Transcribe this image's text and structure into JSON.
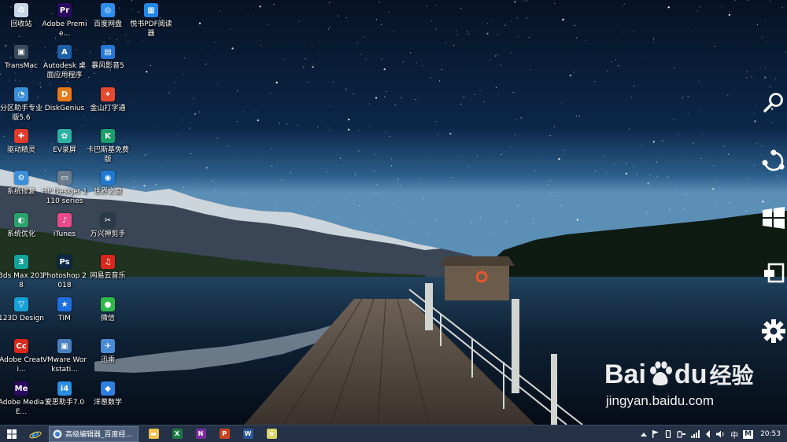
{
  "desktop": {
    "icons": [
      {
        "label": "回收站",
        "icon": "recycle-bin-icon",
        "color": "#c9d6e6",
        "glyph": "♻"
      },
      {
        "label": "Adobe Premie...",
        "icon": "premiere-icon",
        "color": "#2a0a5e",
        "glyph": "Pr"
      },
      {
        "label": "百度网盘",
        "icon": "baidu-netdisk-icon",
        "color": "#2d8cf0",
        "glyph": "◎"
      },
      {
        "label": "悦书PDF阅读器",
        "icon": "pdf-reader-icon",
        "color": "#1f87e8",
        "glyph": "▦"
      },
      {
        "label": "TransMac",
        "icon": "transmac-icon",
        "color": "#3b4a5a",
        "glyph": "▣"
      },
      {
        "label": "Autodesk 桌面应用程序",
        "icon": "autodesk-icon",
        "color": "#1b5fa8",
        "glyph": "A"
      },
      {
        "label": "暴风影音5",
        "icon": "baofeng-icon",
        "color": "#2477d6",
        "glyph": "▤"
      },
      {
        "label": "分区助手专业版5.6",
        "icon": "partition-assistant-icon",
        "color": "#3a8fd8",
        "glyph": "◔"
      },
      {
        "label": "DiskGenius",
        "icon": "diskgenius-icon",
        "color": "#e87a1c",
        "glyph": "D"
      },
      {
        "label": "金山打字通",
        "icon": "kingsoft-typing-icon",
        "color": "#e64a2e",
        "glyph": "✦"
      },
      {
        "label": "驱动精灵",
        "icon": "driver-genius-icon",
        "color": "#e23b2a",
        "glyph": "✚"
      },
      {
        "label": "EV录屏",
        "icon": "ev-recorder-icon",
        "color": "#2db3a3",
        "glyph": "✿"
      },
      {
        "label": "卡巴斯基免费版",
        "icon": "kaspersky-icon",
        "color": "#1a9e6a",
        "glyph": "K"
      },
      {
        "label": "系统修复",
        "icon": "system-repair-icon",
        "color": "#3a8fd8",
        "glyph": "⚙"
      },
      {
        "label": "HP DeskJet 1110 series",
        "icon": "hp-printer-icon",
        "color": "#6b7c8e",
        "glyph": "▭"
      },
      {
        "label": "世界之窗",
        "icon": "theworld-browser-icon",
        "color": "#1f78d1",
        "glyph": "◉"
      },
      {
        "label": "系统优化",
        "icon": "system-optimize-icon",
        "color": "#29a36a",
        "glyph": "◐"
      },
      {
        "label": "iTunes",
        "icon": "itunes-icon",
        "color": "#e84a8a",
        "glyph": "♪"
      },
      {
        "label": "万兴神剪手",
        "icon": "filmora-icon",
        "color": "#2a3a4a",
        "glyph": "✂"
      },
      {
        "label": "3ds Max 2018",
        "icon": "3dsmax-icon",
        "color": "#13a39a",
        "glyph": "3"
      },
      {
        "label": "Photoshop 2018",
        "icon": "photoshop-icon",
        "color": "#0b2744",
        "glyph": "Ps"
      },
      {
        "label": "网易云音乐",
        "icon": "netease-music-icon",
        "color": "#d8281e",
        "glyph": "♫"
      },
      {
        "label": "123D Design",
        "icon": "123d-design-icon",
        "color": "#17a0d8",
        "glyph": "▽"
      },
      {
        "label": "TIM",
        "icon": "tim-icon",
        "color": "#1e6fe0",
        "glyph": "★"
      },
      {
        "label": "微信",
        "icon": "wechat-icon",
        "color": "#2fb94a",
        "glyph": "●"
      },
      {
        "label": "Adobe Creati...",
        "icon": "creative-cloud-icon",
        "color": "#d8281e",
        "glyph": "Cc"
      },
      {
        "label": "VMware Workstati...",
        "icon": "vmware-icon",
        "color": "#4a7fbf",
        "glyph": "▣"
      },
      {
        "label": "迅雷",
        "icon": "xunlei-icon",
        "color": "#4b8bd6",
        "glyph": "✈"
      },
      {
        "label": "Adobe Media E...",
        "icon": "media-encoder-icon",
        "color": "#2a0a5e",
        "glyph": "Me"
      },
      {
        "label": "爱思助手7.0",
        "icon": "i4-assistant-icon",
        "color": "#2a8de0",
        "glyph": "i4"
      },
      {
        "label": "洋葱数学",
        "icon": "onion-math-icon",
        "color": "#2f7fe0",
        "glyph": "◆"
      }
    ]
  },
  "charms": [
    {
      "name": "search-charm",
      "icon": "search-icon"
    },
    {
      "name": "share-charm",
      "icon": "share-icon"
    },
    {
      "name": "start-charm",
      "icon": "windows-logo-icon"
    },
    {
      "name": "devices-charm",
      "icon": "devices-icon"
    },
    {
      "name": "settings-charm",
      "icon": "gear-icon"
    }
  ],
  "watermark": {
    "logo_text_a": "Bai",
    "logo_text_b": "du",
    "logo_cn": "经验",
    "url": "jingyan.baidu.com"
  },
  "taskbar": {
    "active_window_title": "高级编辑器_百度经...",
    "pinned": [
      {
        "name": "file-explorer",
        "icon": "folder-icon",
        "color": "#f2c14e",
        "glyph": "▬"
      },
      {
        "name": "excel",
        "icon": "excel-icon",
        "color": "#1e7a44",
        "glyph": "X"
      },
      {
        "name": "onenote",
        "icon": "onenote-icon",
        "color": "#7a2d9c",
        "glyph": "N"
      },
      {
        "name": "powerpoint",
        "icon": "powerpoint-icon",
        "color": "#c9441f",
        "glyph": "P"
      },
      {
        "name": "word",
        "icon": "word-icon",
        "color": "#2b5797",
        "glyph": "W"
      },
      {
        "name": "notepad",
        "icon": "notepad-icon",
        "color": "#d9d36a",
        "glyph": "≡"
      }
    ],
    "tray": {
      "ime_label": "中",
      "ime_mode": "M",
      "clock": "20:53"
    }
  },
  "colors": {
    "taskbar_bg": "#243146",
    "active_window_bg": "#4a5b77"
  }
}
